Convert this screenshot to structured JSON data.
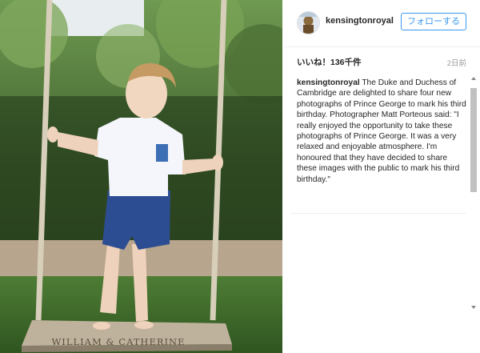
{
  "post": {
    "username": "kensingtonroyal",
    "follow_label": "フォローする",
    "likes": "いいね！136千件",
    "time": "2日前",
    "caption_user": "kensingtonroyal",
    "caption_text": " The Duke and Duchess of Cambridge are delighted to share four new photographs of Prince George to mark his third birthday. Photographer Matt Porteous said: \"I really enjoyed the opportunity to take these photographs of Prince George. It was a very relaxed and enjoyable atmosphere. I'm honoured that they have decided to share these images with the public to mark his third birthday.\""
  },
  "photo": {
    "seat_engraving": "WILLIAM & CATHERINE"
  },
  "colors": {
    "accent": "#3897f0",
    "text": "#262626",
    "muted": "#999999"
  }
}
